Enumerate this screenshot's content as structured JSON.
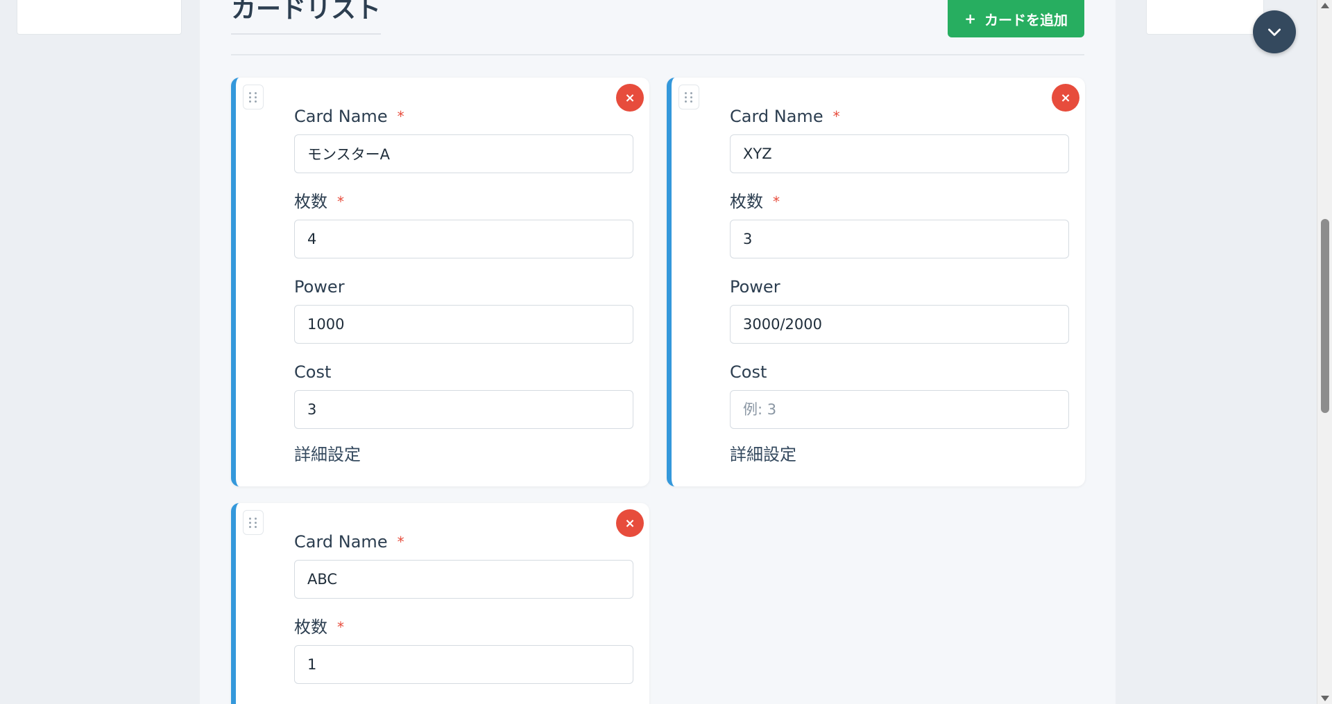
{
  "header": {
    "title": "カードリスト",
    "add_button": "カードを追加",
    "add_icon": "plus-icon"
  },
  "cards": [
    {
      "fields": [
        {
          "label": "Card Name",
          "required": true,
          "value": "モンスターA",
          "placeholder": ""
        },
        {
          "label": "枚数",
          "required": true,
          "value": "4",
          "placeholder": ""
        },
        {
          "label": "Power",
          "required": false,
          "value": "1000",
          "placeholder": ""
        },
        {
          "label": "Cost",
          "required": false,
          "value": "3",
          "placeholder": ""
        }
      ],
      "details": "詳細設定"
    },
    {
      "fields": [
        {
          "label": "Card Name",
          "required": true,
          "value": "XYZ",
          "placeholder": ""
        },
        {
          "label": "枚数",
          "required": true,
          "value": "3",
          "placeholder": ""
        },
        {
          "label": "Power",
          "required": false,
          "value": "3000/2000",
          "placeholder": ""
        },
        {
          "label": "Cost",
          "required": false,
          "value": "",
          "placeholder": "例: 3"
        }
      ],
      "details": "詳細設定"
    },
    {
      "fields": [
        {
          "label": "Card Name",
          "required": true,
          "value": "ABC",
          "placeholder": ""
        },
        {
          "label": "枚数",
          "required": true,
          "value": "1",
          "placeholder": ""
        }
      ]
    }
  ],
  "required_mark": "*",
  "remove_icon": "×",
  "colors": {
    "accent": "#3498db",
    "add_button": "#27ae60",
    "remove": "#e74c3c",
    "fab": "#34495e"
  },
  "fab_icon": "chevron-down-icon"
}
